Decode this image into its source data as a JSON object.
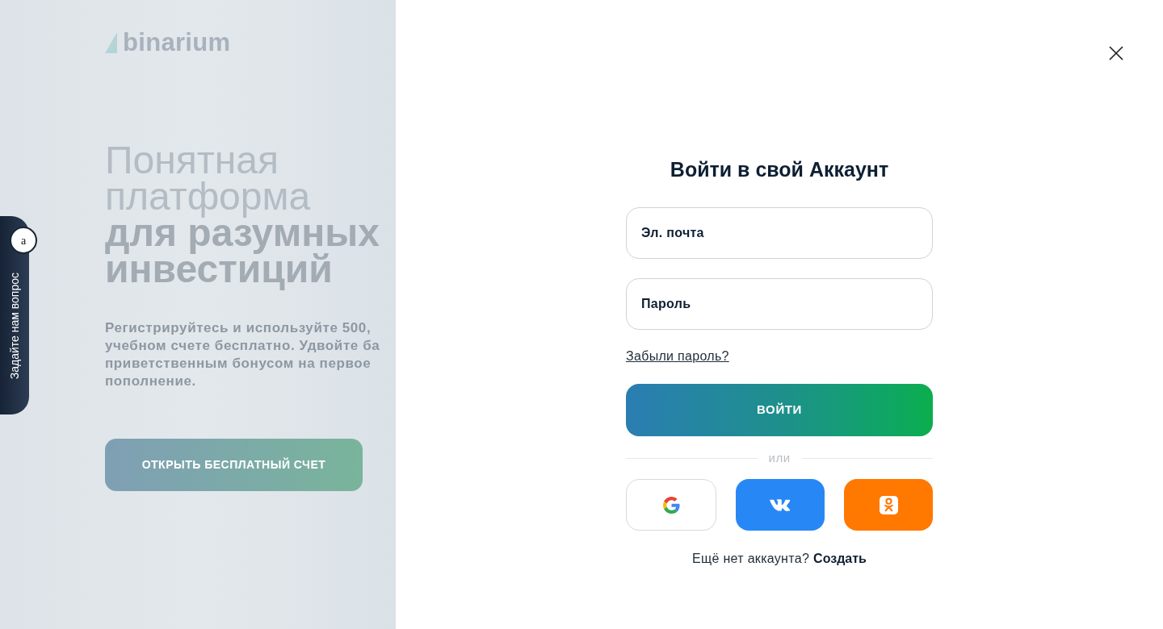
{
  "feedback_tab": {
    "label": "Задайте нам вопрос",
    "badge": "a"
  },
  "promo": {
    "logo": "binarium",
    "headline_lines": [
      "Понятная",
      "платформа",
      "**для разумных**",
      "**инвестиций**"
    ],
    "description_lines": [
      "Регистрируйтесь и используйте 500,",
      "учебном счете бесплатно. Удвойте ба",
      "приветственным бонусом на первое",
      "пополнение."
    ],
    "cta_button": "ОТКРЫТЬ БЕСПЛАТНЫЙ СЧЕТ"
  },
  "login": {
    "title": "Войти в свой Аккаунт",
    "fields": [
      {
        "placeholder": "Эл. почта"
      },
      {
        "placeholder": "Пароль"
      }
    ],
    "forgot_link": "Забыли пароль?",
    "submit_button": "ВОЙТИ",
    "divider": "или",
    "social_buttons": [
      {
        "kind": "google"
      },
      {
        "kind": "vk"
      },
      {
        "kind": "ok"
      }
    ],
    "signup_prompt": "Ещё нет аккаунта?",
    "signup_link": "Создать"
  }
}
